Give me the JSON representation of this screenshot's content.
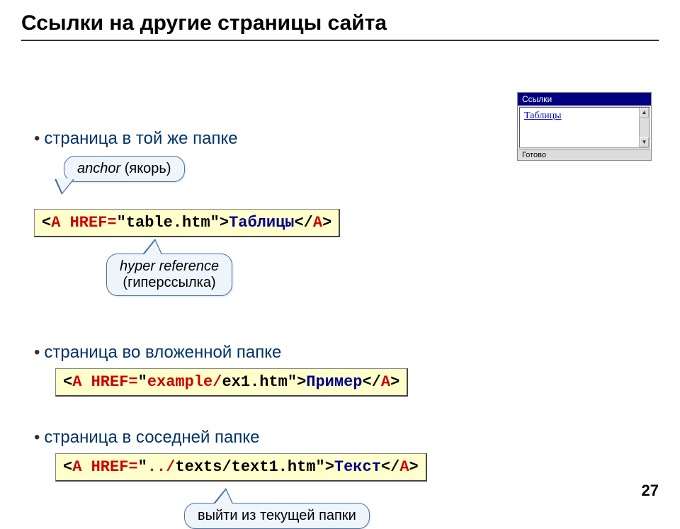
{
  "title": "Ссылки на другие страницы сайта",
  "bullets": {
    "b1": "страница в той же папке",
    "b2": "страница во вложенной папке",
    "b3": "страница в соседней папке"
  },
  "callouts": {
    "anchor_line1": "anchor",
    "anchor_line2": " (якорь)",
    "hyper_line1": "hyper reference",
    "hyper_line2": "(гиперссылка)",
    "exit": "выйти из текущей папки"
  },
  "code1": {
    "open": "<",
    "A": "A",
    "sp": " ",
    "HREF": "HREF=",
    "q1": "\"",
    "file": "table.htm",
    "q2": "\"",
    "gt": ">",
    "text": "Таблицы",
    "close1": "</",
    "A2": "A",
    "close2": ">"
  },
  "code2": {
    "open": "<",
    "A": "A",
    "sp": " ",
    "HREF": "HREF=",
    "q1": "\"",
    "path": "example/",
    "file": "ex1.htm",
    "q2": "\"",
    "gt": ">",
    "text": "Пример",
    "close1": "</",
    "A2": "A",
    "close2": ">"
  },
  "code3": {
    "open": "<",
    "A": "A",
    "sp": " ",
    "HREF": "HREF=",
    "q1": "\"",
    "path": "../",
    "dir": "texts/",
    "file": "text1.htm",
    "q2": "\"",
    "gt": ">",
    "text": "Текст",
    "close1": "</",
    "A2": "A",
    "close2": ">"
  },
  "miniwin": {
    "title": "Ссылки",
    "link": "Таблицы",
    "status": "Готово"
  },
  "page_number": "27"
}
